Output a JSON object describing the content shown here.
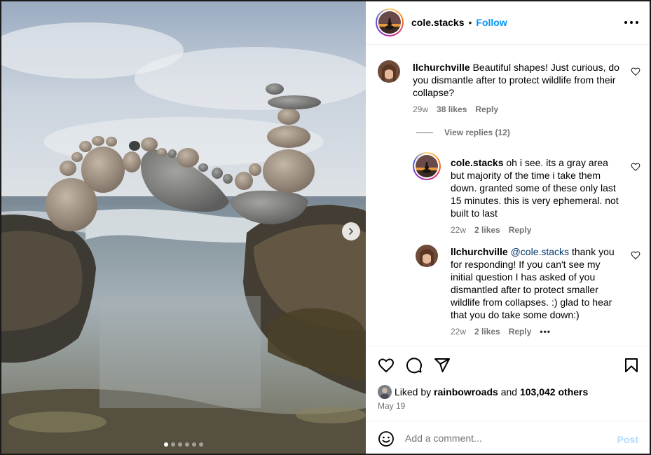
{
  "post": {
    "author": "cole.stacks",
    "follow_label": "Follow",
    "separator": "•",
    "more_icon": "more-horizontal-icon"
  },
  "carousel": {
    "slide_count": 6,
    "active_index": 0,
    "next_icon": "chevron-right-icon"
  },
  "comments": [
    {
      "username": "llchurchville",
      "text": "Beautiful shapes! Just curious, do you dismantle after to protect wildlife from their collapse?",
      "age": "29w",
      "likes": "38 likes",
      "reply": "Reply"
    }
  ],
  "view_replies": "View replies (12)",
  "replies": [
    {
      "username": "cole.stacks",
      "text": "oh i see. its a gray area but majority of the time i take them down. granted some of these only last 15 minutes. this is very ephemeral. not built to last",
      "age": "22w",
      "likes": "2 likes",
      "reply": "Reply"
    },
    {
      "username": "llchurchville",
      "mention": "@cole.stacks",
      "text": "thank you for responding! If you can't see my initial question I has asked of you dismantled after to protect smaller wildlife from collapses. :) glad to hear that you do take some down:)",
      "age": "22w",
      "likes": "2 likes",
      "reply": "Reply",
      "more": "•••"
    }
  ],
  "liked_by": {
    "prefix": "Liked by",
    "user": "rainbowroads",
    "conj": "and",
    "others": "103,042 others"
  },
  "date": "May 19",
  "add_comment": {
    "placeholder": "Add a comment...",
    "post_label": "Post"
  },
  "colors": {
    "link_blue": "#0095f6",
    "post_disabled": "#b3dbff",
    "muted": "#737373"
  }
}
